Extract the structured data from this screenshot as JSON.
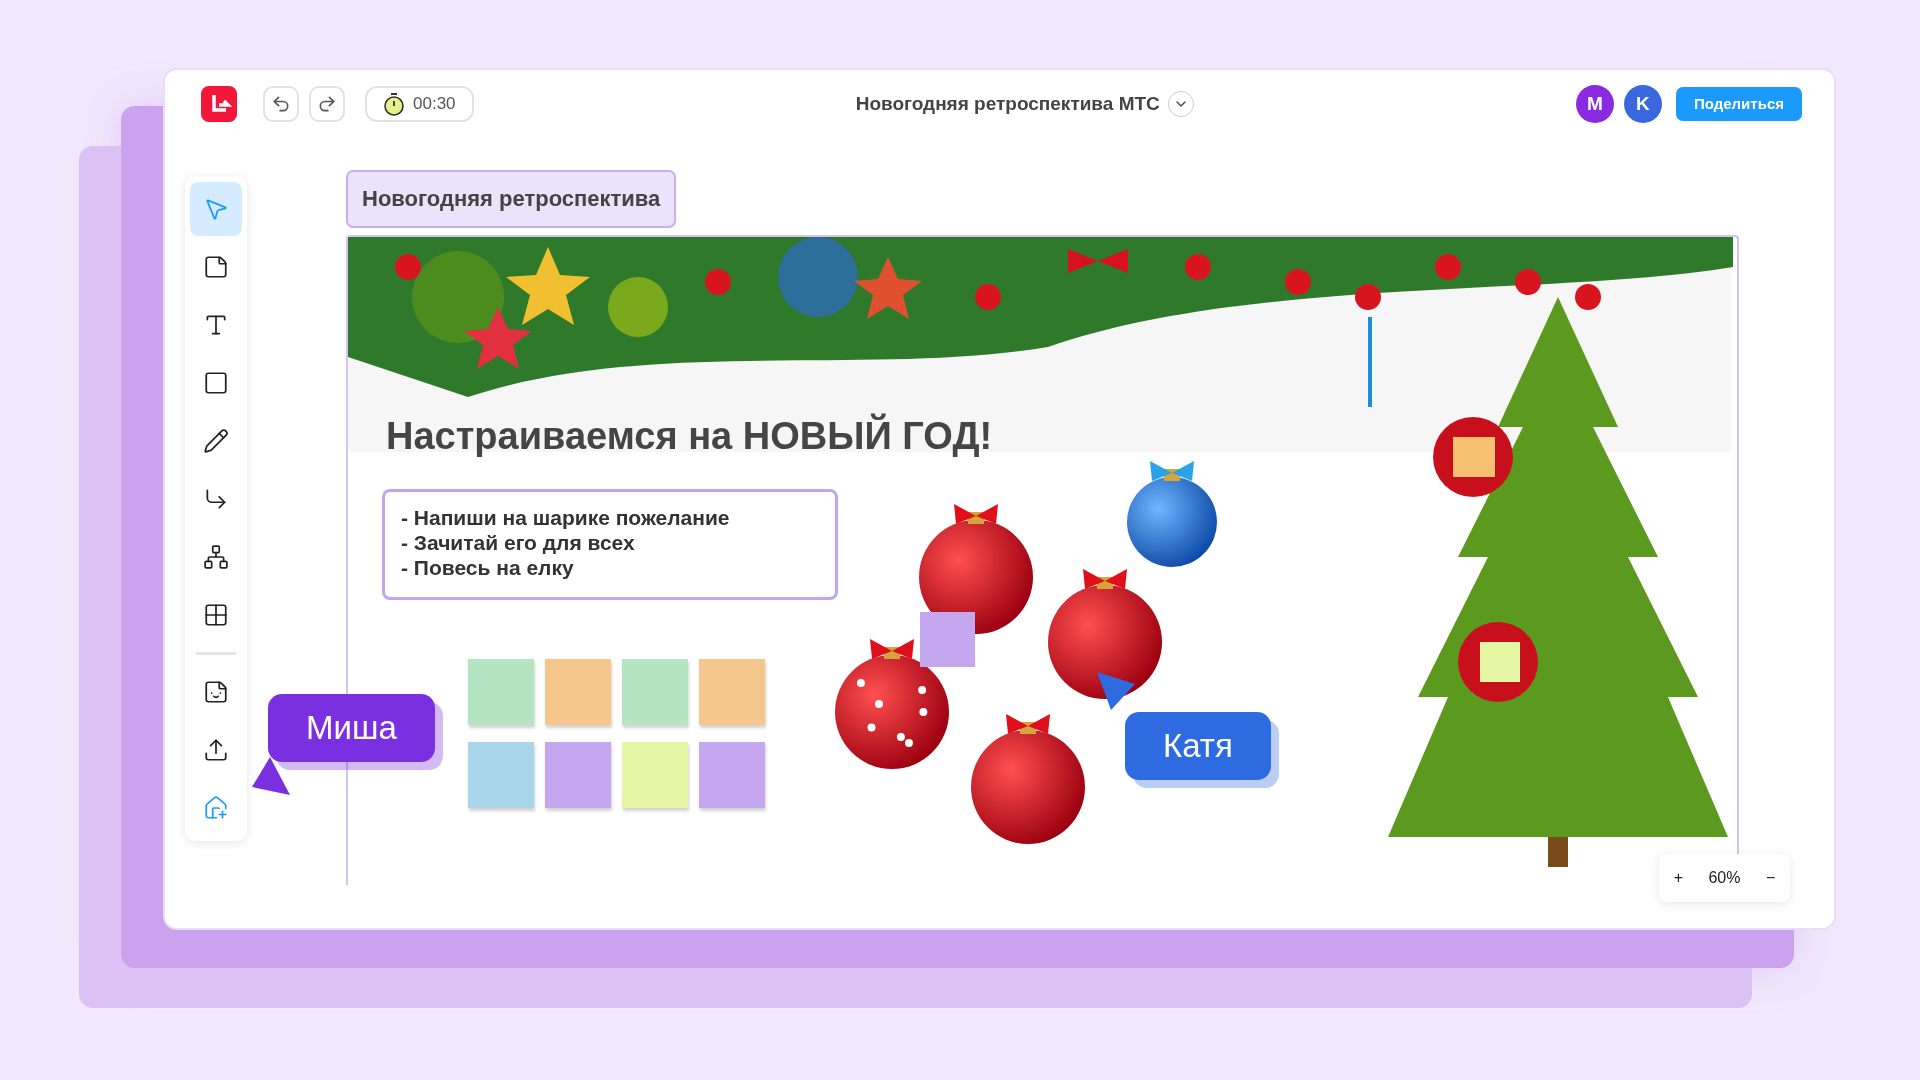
{
  "topbar": {
    "timer": "00:30",
    "title": "Новогодняя ретроспектива МТС",
    "avatars": [
      {
        "letter": "M",
        "color": "#8a2be2"
      },
      {
        "letter": "K",
        "color": "#3a66de"
      }
    ],
    "share_label": "Поделиться"
  },
  "tools": [
    {
      "kind": "select",
      "selected": true
    },
    {
      "kind": "sticky",
      "selected": false
    },
    {
      "kind": "text",
      "selected": false
    },
    {
      "kind": "shape",
      "selected": false
    },
    {
      "kind": "pen",
      "selected": false
    },
    {
      "kind": "connector",
      "selected": false
    },
    {
      "kind": "mindmap",
      "selected": false
    },
    {
      "kind": "table",
      "selected": false
    }
  ],
  "extra_tools": [
    {
      "kind": "sticker",
      "selected": false
    },
    {
      "kind": "upload",
      "selected": false
    },
    {
      "kind": "template",
      "selected": false
    }
  ],
  "frame_title": "Новогодняя ретроспектива",
  "board": {
    "heading": "Настраиваемся на НОВЫЙ ГОД!",
    "instructions": [
      "- Напиши на шарике пожелание",
      "- Зачитай его для всех",
      "- Повесь на елку"
    ],
    "stickies": [
      {
        "color": "#b4e4c2"
      },
      {
        "color": "#f6c78d"
      },
      {
        "color": "#b4e4c2"
      },
      {
        "color": "#f6c78d"
      },
      {
        "color": "#a9d5ea"
      },
      {
        "color": "#c4a7ee"
      },
      {
        "color": "#e5f7a5"
      },
      {
        "color": "#c4a7ee"
      }
    ],
    "cursors": [
      {
        "name": "Миша",
        "color": "#7a2fe0"
      },
      {
        "name": "Катя",
        "color": "#2f6be0"
      }
    ]
  },
  "zoom": {
    "plus": "+",
    "level": "60%",
    "minus": "−"
  }
}
